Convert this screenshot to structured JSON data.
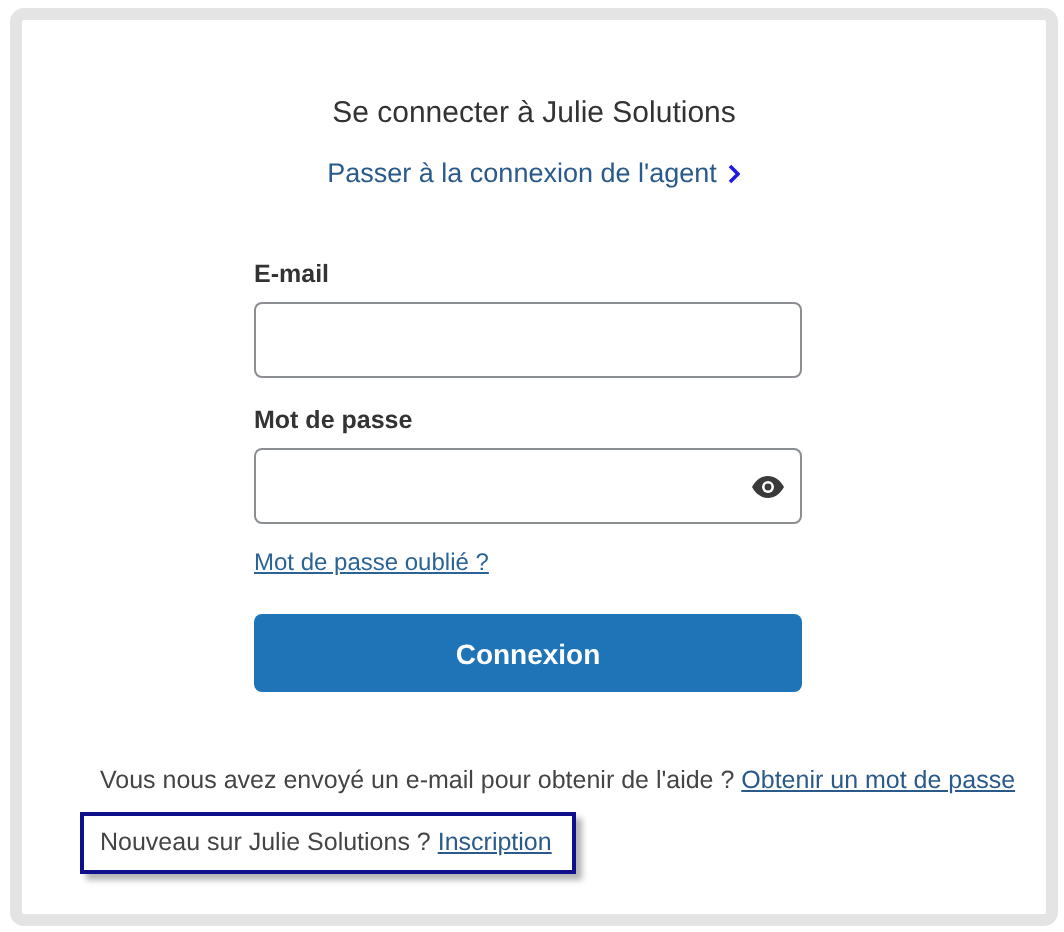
{
  "title": "Se connecter à Julie Solutions",
  "agent_link": "Passer à la connexion de l'agent",
  "fields": [
    {
      "label": "E-mail",
      "reveal_toggle": false
    },
    {
      "label": "Mot de passe",
      "reveal_toggle": true
    }
  ],
  "forgot_link": "Mot de passe oublié ?",
  "submit_button": "Connexion",
  "footer": [
    {
      "text": "Vous nous avez envoyé un e-mail pour obtenir de l'aide ?",
      "link": "Obtenir un mot de passe",
      "highlighted": false
    },
    {
      "text": "Nouveau sur Julie Solutions ?",
      "link": "Inscription",
      "highlighted": true
    }
  ]
}
